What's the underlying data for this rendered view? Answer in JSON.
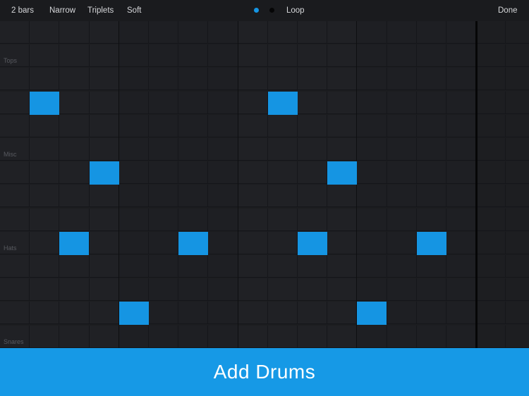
{
  "toolbar": {
    "length": "2 bars",
    "narrow": "Narrow",
    "triplets": "Triplets",
    "soft": "Soft",
    "loop": "Loop",
    "done": "Done"
  },
  "colors": {
    "accent": "#1595e3",
    "button": "#1699e6",
    "background": "#1c1d20"
  },
  "grid": {
    "columns": 18,
    "rows": 14,
    "loop_end_column": 16,
    "labels": [
      {
        "row": 1,
        "text": "Tops"
      },
      {
        "row": 5,
        "text": "Misc"
      },
      {
        "row": 9,
        "text": "Hats"
      },
      {
        "row": 13,
        "text": "Snares"
      }
    ],
    "notes": [
      {
        "row": 3,
        "col": 1
      },
      {
        "row": 3,
        "col": 9
      },
      {
        "row": 6,
        "col": 3
      },
      {
        "row": 6,
        "col": 11
      },
      {
        "row": 9,
        "col": 2
      },
      {
        "row": 9,
        "col": 6
      },
      {
        "row": 9,
        "col": 10
      },
      {
        "row": 9,
        "col": 14
      },
      {
        "row": 12,
        "col": 4
      },
      {
        "row": 12,
        "col": 12
      }
    ]
  },
  "add_button": {
    "label": "Add Drums"
  }
}
